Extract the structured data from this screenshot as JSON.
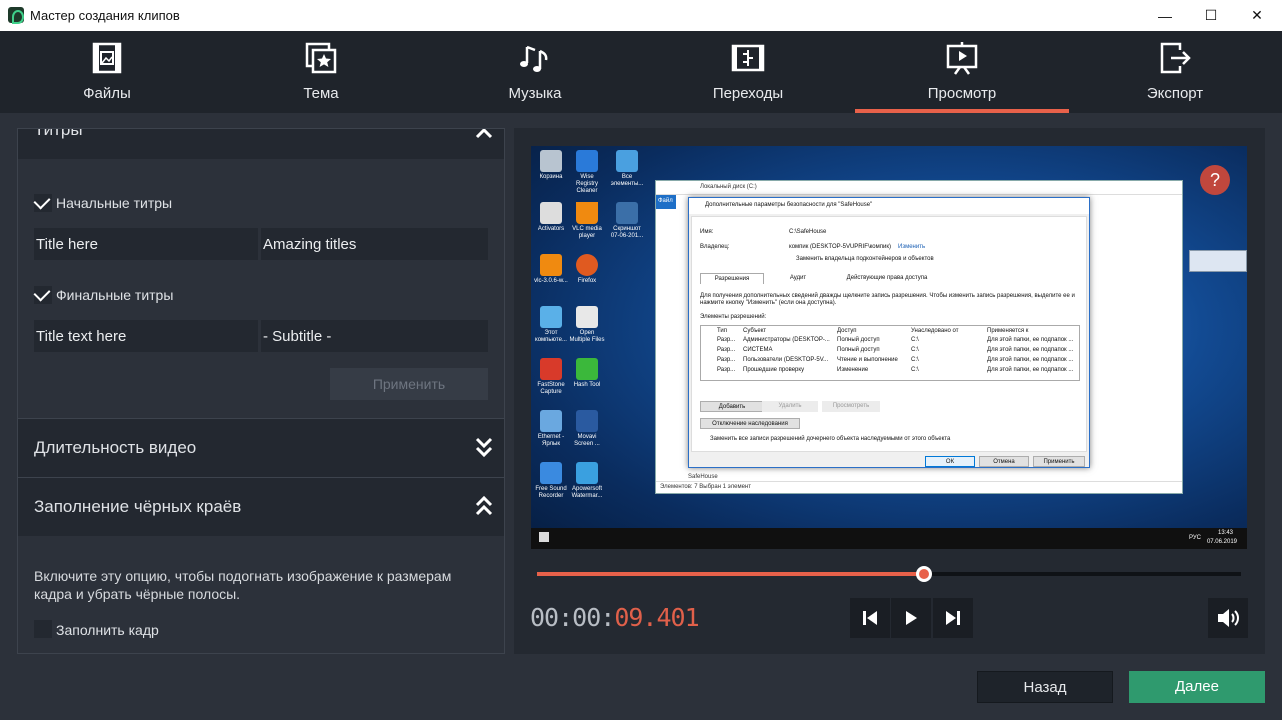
{
  "window": {
    "title": "Мастер создания клипов",
    "controls": {
      "minimize": "—",
      "maximize": "☐",
      "close": "✕"
    }
  },
  "tabs": [
    {
      "label": "Файлы",
      "icon": "files-icon",
      "active": false
    },
    {
      "label": "Тема",
      "icon": "theme-icon",
      "active": false
    },
    {
      "label": "Музыка",
      "icon": "music-icon",
      "active": false
    },
    {
      "label": "Переходы",
      "icon": "transitions-icon",
      "active": false
    },
    {
      "label": "Просмотр",
      "icon": "preview-icon",
      "active": true
    },
    {
      "label": "Экспорт",
      "icon": "export-icon",
      "active": false
    }
  ],
  "titles_section": {
    "header": "Титры",
    "opening": {
      "label": "Начальные титры",
      "checked": true,
      "title_value": "Title here",
      "subtitle_value": "Amazing titles"
    },
    "closing": {
      "label": "Финальные титры",
      "checked": true,
      "title_value": "Title text here",
      "subtitle_value": "- Subtitle -"
    },
    "apply_label": "Применить"
  },
  "duration_section": {
    "header": "Длительность видео"
  },
  "fill_section": {
    "header": "Заполнение чёрных краёв",
    "description": "Включите эту опцию, чтобы подогнать изображение к размерам кадра и убрать чёрные полосы.",
    "checkbox_label": "Заполнить кадр",
    "checked": false
  },
  "preview": {
    "desktop_icons": [
      {
        "label": "Корзина"
      },
      {
        "label": "Wise Registry Cleaner"
      },
      {
        "label": "Все элементы..."
      },
      {
        "label": "Activators"
      },
      {
        "label": "VLC media player"
      },
      {
        "label": "Скриншот 07-06-201..."
      },
      {
        "label": "vlc-3.0.6-w..."
      },
      {
        "label": "Firefox"
      },
      {
        "label": "Этот компьюте..."
      },
      {
        "label": "Open Multiple Files"
      },
      {
        "label": "FastStone Capture"
      },
      {
        "label": "Hash Tool"
      },
      {
        "label": "Ethernet - Ярлык"
      },
      {
        "label": "Movavi Screen ..."
      },
      {
        "label": "Free Sound Recorder"
      },
      {
        "label": "Apowersoft Watermar..."
      }
    ],
    "explorer_title": "Локальный диск (C:)",
    "dialog": {
      "title": "Дополнительные параметры безопасности для \"SafeHouse\"",
      "name_label": "Имя:",
      "name_value": "C:\\SafeHouse",
      "owner_label": "Владелец:",
      "owner_value": "компик (DESKTOP-5VUPRIF\\компик)",
      "owner_change": "Изменить",
      "replace_owner": "Заменить владельца подконтейнеров и объектов",
      "tabs": [
        "Разрешения",
        "Аудит",
        "Действующие права доступа"
      ],
      "info": "Для получения дополнительных сведений дважды щелкните запись разрешения. Чтобы изменить запись разрешения, выделите ее и нажмите кнопку \"Изменить\" (если она доступна).",
      "entries_label": "Элементы разрешений:",
      "columns": [
        "Тип",
        "Субъект",
        "Доступ",
        "Унаследовано от",
        "Применяется к"
      ],
      "rows": [
        [
          "Разр...",
          "Администраторы (DESKTOP-...",
          "Полный доступ",
          "C:\\",
          "Для этой папки, ее подпапок ..."
        ],
        [
          "Разр...",
          "СИСТЕМА",
          "Полный доступ",
          "C:\\",
          "Для этой папки, ее подпапок ..."
        ],
        [
          "Разр...",
          "Пользователи (DESKTOP-5V...",
          "Чтение и выполнение",
          "C:\\",
          "Для этой папки, ее подпапок ..."
        ],
        [
          "Разр...",
          "Прошедшие проверку",
          "Изменение",
          "C:\\",
          "Для этой папки, ее подпапок ..."
        ]
      ],
      "btn_add": "Добавить",
      "btn_remove": "Удалить",
      "btn_view": "Просмотреть",
      "btn_disable_inherit": "Отключение наследования",
      "replace_children": "Заменить все записи разрешений дочернего объекта наследуемыми от этого объекта",
      "btn_ok": "ОК",
      "btn_cancel": "Отмена",
      "btn_apply": "Применить"
    },
    "explorer_status": "Элементов: 7    Выбран 1 элемент",
    "explorer_item": "SafeHouse",
    "taskbar_lang": "РУС",
    "taskbar_time": "13:43",
    "taskbar_date": "07.06.2019",
    "help_glyph": "?"
  },
  "player": {
    "progress": 0.55,
    "time_dim": "00:00:",
    "time_hi": "09.401"
  },
  "footer": {
    "back": "Назад",
    "next": "Далее"
  },
  "colors": {
    "accent": "#e8614a",
    "next_button": "#2f9a6e",
    "panel": "#2c313a",
    "header": "#1f242b"
  }
}
